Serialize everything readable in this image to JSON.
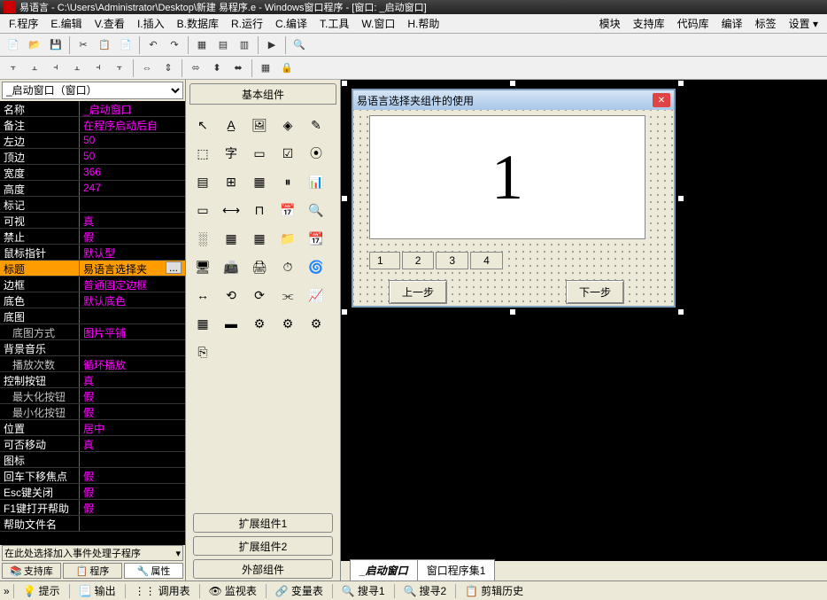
{
  "title": "易语言 - C:\\Users\\Administrator\\Desktop\\新建 易程序.e - Windows窗口程序 - [窗口: _启动窗口]",
  "menu": [
    "F.程序",
    "E.编辑",
    "V.查看",
    "I.插入",
    "B.数据库",
    "R.运行",
    "C.编译",
    "T.工具",
    "W.窗口",
    "H.帮助"
  ],
  "menu_right": [
    "模块",
    "支持库",
    "代码库",
    "编译",
    "标签",
    "设置 ▾"
  ],
  "prop_select": "_启动窗口（窗口）",
  "properties": [
    {
      "name": "名称",
      "val": "_启动窗口"
    },
    {
      "name": "备注",
      "val": "在程序启动后自"
    },
    {
      "name": "左边",
      "val": "50"
    },
    {
      "name": "顶边",
      "val": "50"
    },
    {
      "name": "宽度",
      "val": "366"
    },
    {
      "name": "高度",
      "val": "247"
    },
    {
      "name": "标记",
      "val": ""
    },
    {
      "name": "可视",
      "val": "真"
    },
    {
      "name": "禁止",
      "val": "假"
    },
    {
      "name": "鼠标指针",
      "val": "默认型"
    },
    {
      "name": "标题",
      "val": "易语言选择夹",
      "selected": true,
      "ellipsis": true
    },
    {
      "name": "边框",
      "val": "普通固定边框"
    },
    {
      "name": "底色",
      "val": "默认底色"
    },
    {
      "name": "底图",
      "val": ""
    },
    {
      "name": "底图方式",
      "val": "图片平铺",
      "indent": true
    },
    {
      "name": "背景音乐",
      "val": ""
    },
    {
      "name": "播放次数",
      "val": "循环播放",
      "indent": true
    },
    {
      "name": "控制按钮",
      "val": "真"
    },
    {
      "name": "最大化按钮",
      "val": "假",
      "indent": true
    },
    {
      "name": "最小化按钮",
      "val": "假",
      "indent": true
    },
    {
      "name": "位置",
      "val": "居中"
    },
    {
      "name": "可否移动",
      "val": "真"
    },
    {
      "name": "图标",
      "val": ""
    },
    {
      "name": "回车下移焦点",
      "val": "假"
    },
    {
      "name": "Esc键关闭",
      "val": "假"
    },
    {
      "name": "F1键打开帮助",
      "val": "假"
    },
    {
      "name": "帮助文件名",
      "val": ""
    }
  ],
  "prop_footer": "在此处选择加入事件处理子程序",
  "left_tabs": [
    "支持库",
    "程序",
    "属性"
  ],
  "comp_header": "基本组件",
  "comp_footer": [
    "扩展组件1",
    "扩展组件2",
    "外部组件"
  ],
  "form": {
    "title": "易语言选择夹组件的使用",
    "display": "1",
    "tabs": [
      "1",
      "2",
      "3",
      "4"
    ],
    "btn_prev": "上一步",
    "btn_next": "下一步"
  },
  "design_tabs": [
    "_启动窗口",
    "窗口程序集1"
  ],
  "bottom": [
    "提示",
    "输出",
    "调用表",
    "监视表",
    "变量表",
    "搜寻1",
    "搜寻2",
    "剪辑历史"
  ]
}
